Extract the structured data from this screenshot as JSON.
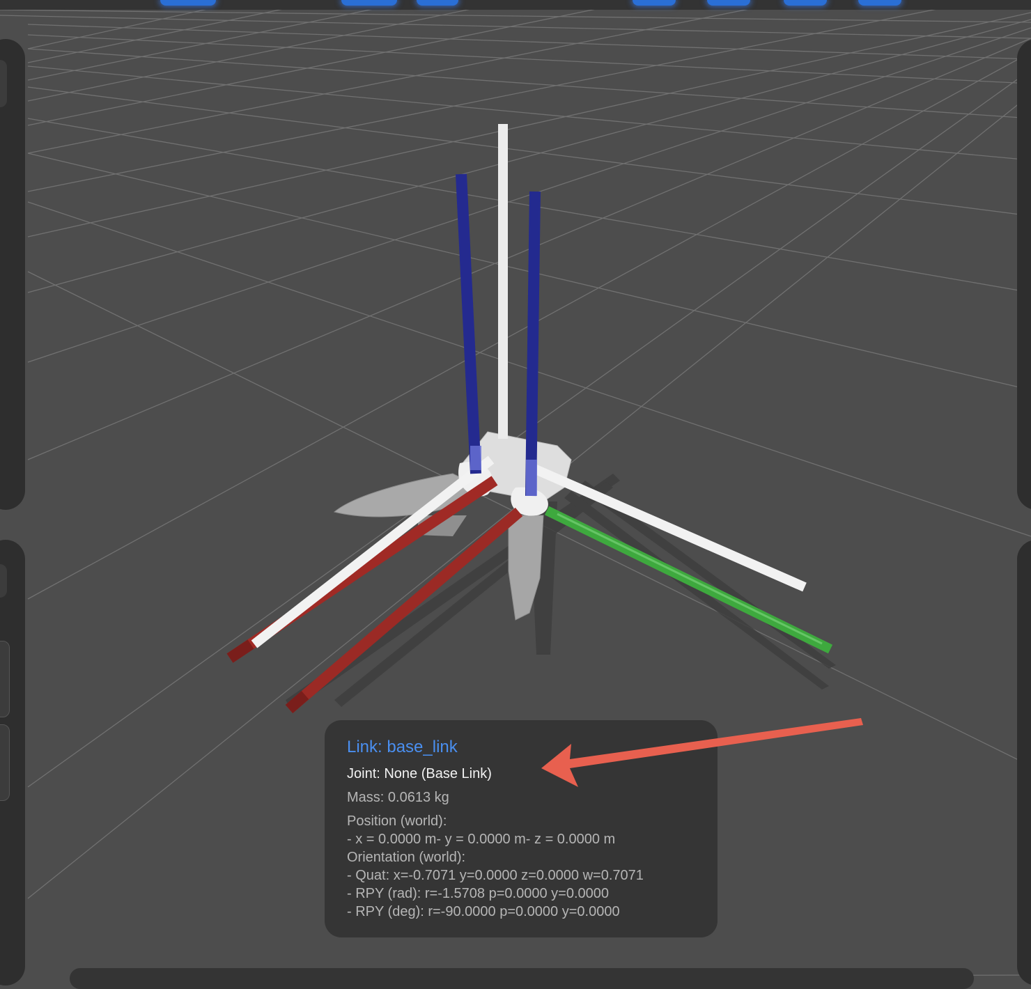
{
  "viewport": {
    "background": "#4d4d4d",
    "grid_color": "#7a7a7a",
    "axis_colors": {
      "x": "#9b2a25",
      "y": "#3aa33a",
      "z": "#222a8c"
    }
  },
  "info_card": {
    "title": "Link: base_link",
    "joint": "Joint: None (Base Link)",
    "mass": "Mass: 0.0613 kg",
    "position_header": "Position (world):",
    "position_line": "- x = 0.0000 m- y = 0.0000 m- z = 0.0000 m",
    "orientation_header": "Orientation (world):",
    "quat_line": "- Quat: x=-0.7071 y=0.0000 z=0.0000 w=0.7071",
    "rpy_rad_line": "- RPY (rad): r=-1.5708 p=0.0000 y=0.0000",
    "rpy_deg_line": "- RPY (deg): r=-90.0000 p=0.0000 y=0.0000",
    "title_color": "#4a8ff0"
  },
  "annotation": {
    "arrow_color": "#e8604f"
  }
}
